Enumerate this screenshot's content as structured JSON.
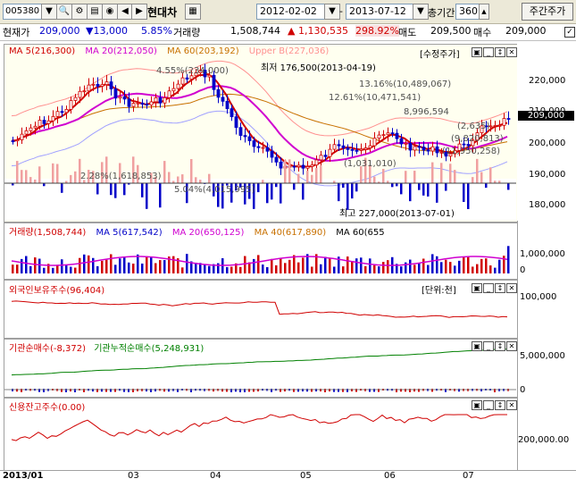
{
  "toolbar": {
    "code": "005380",
    "name": "현대차",
    "start_date": "2012-02-02",
    "end_date": "2013-07-12",
    "period_label": "총기간",
    "period_value": "360",
    "weekly_button": "주간주가"
  },
  "infobar": {
    "current_label": "현재가",
    "current_value": "209,000",
    "change": "▼13,000",
    "change_pct": "5.85%",
    "volume_label": "거래량",
    "volume_value": "1,508,744",
    "volume_change": "▲ 1,130,535",
    "volume_pct": "298.92%",
    "ask_label": "매도",
    "ask_value": "209,500",
    "bid_label": "매수",
    "bid_value": "209,000"
  },
  "price_panel": {
    "legend": {
      "ma5": "MA 5(216,300)",
      "ma20": "MA 20(212,050)",
      "ma60": "MA 60(203,192)",
      "upper": "Upper B(227,036)",
      "adjusted": "[수정주가]"
    },
    "annotations": {
      "low": "최저 176,500(2013-04-19)",
      "high": "최고 227,000(2013-07-01)",
      "a1": "4.55%(234,000)",
      "a2": "13.16%(10,489,067)",
      "a3": "12.61%(10,471,541)",
      "a4": "2.28%(1,618,853)",
      "a5": "5.04%(4,015,995)",
      "a6": "(1,031,010)",
      "a7": "(9,820,813)",
      "a8": "(11,950,258)",
      "a9": "(2,635)",
      "a10": "8,996,594"
    },
    "axis": [
      "220,000",
      "210,000",
      "200,000",
      "190,000",
      "180,000"
    ],
    "current_tag": "209,000"
  },
  "volume_panel": {
    "legend": {
      "vol": "거래량(1,508,744)",
      "ma5": "MA 5(617,542)",
      "ma20": "MA 20(650,125)",
      "ma40": "MA 40(617,890)",
      "ma60": "MA 60(655"
    },
    "axis": [
      "1,000,000",
      "0"
    ]
  },
  "foreign_panel": {
    "legend": "외국인보유주수(96,404)",
    "unit": "[단위:천]",
    "axis": [
      "100,000"
    ]
  },
  "inst_panel": {
    "legend1": "기관순매수(-8,372)",
    "legend2": "기관누적순매수(5,248,931)",
    "axis": [
      "5,000,000",
      "0"
    ]
  },
  "credit_panel": {
    "legend": "신용잔고주수(0.00)",
    "axis": [
      "200,000.00"
    ]
  },
  "xaxis": {
    "labels": [
      "2013/01",
      "03",
      "04",
      "05",
      "06",
      "07"
    ]
  },
  "colors": {
    "up": "#d00000",
    "down": "#0000c8",
    "ma5": "#d00000",
    "ma20": "#d000d0",
    "ma60": "#c87000",
    "band": "#a0a0ff"
  }
}
